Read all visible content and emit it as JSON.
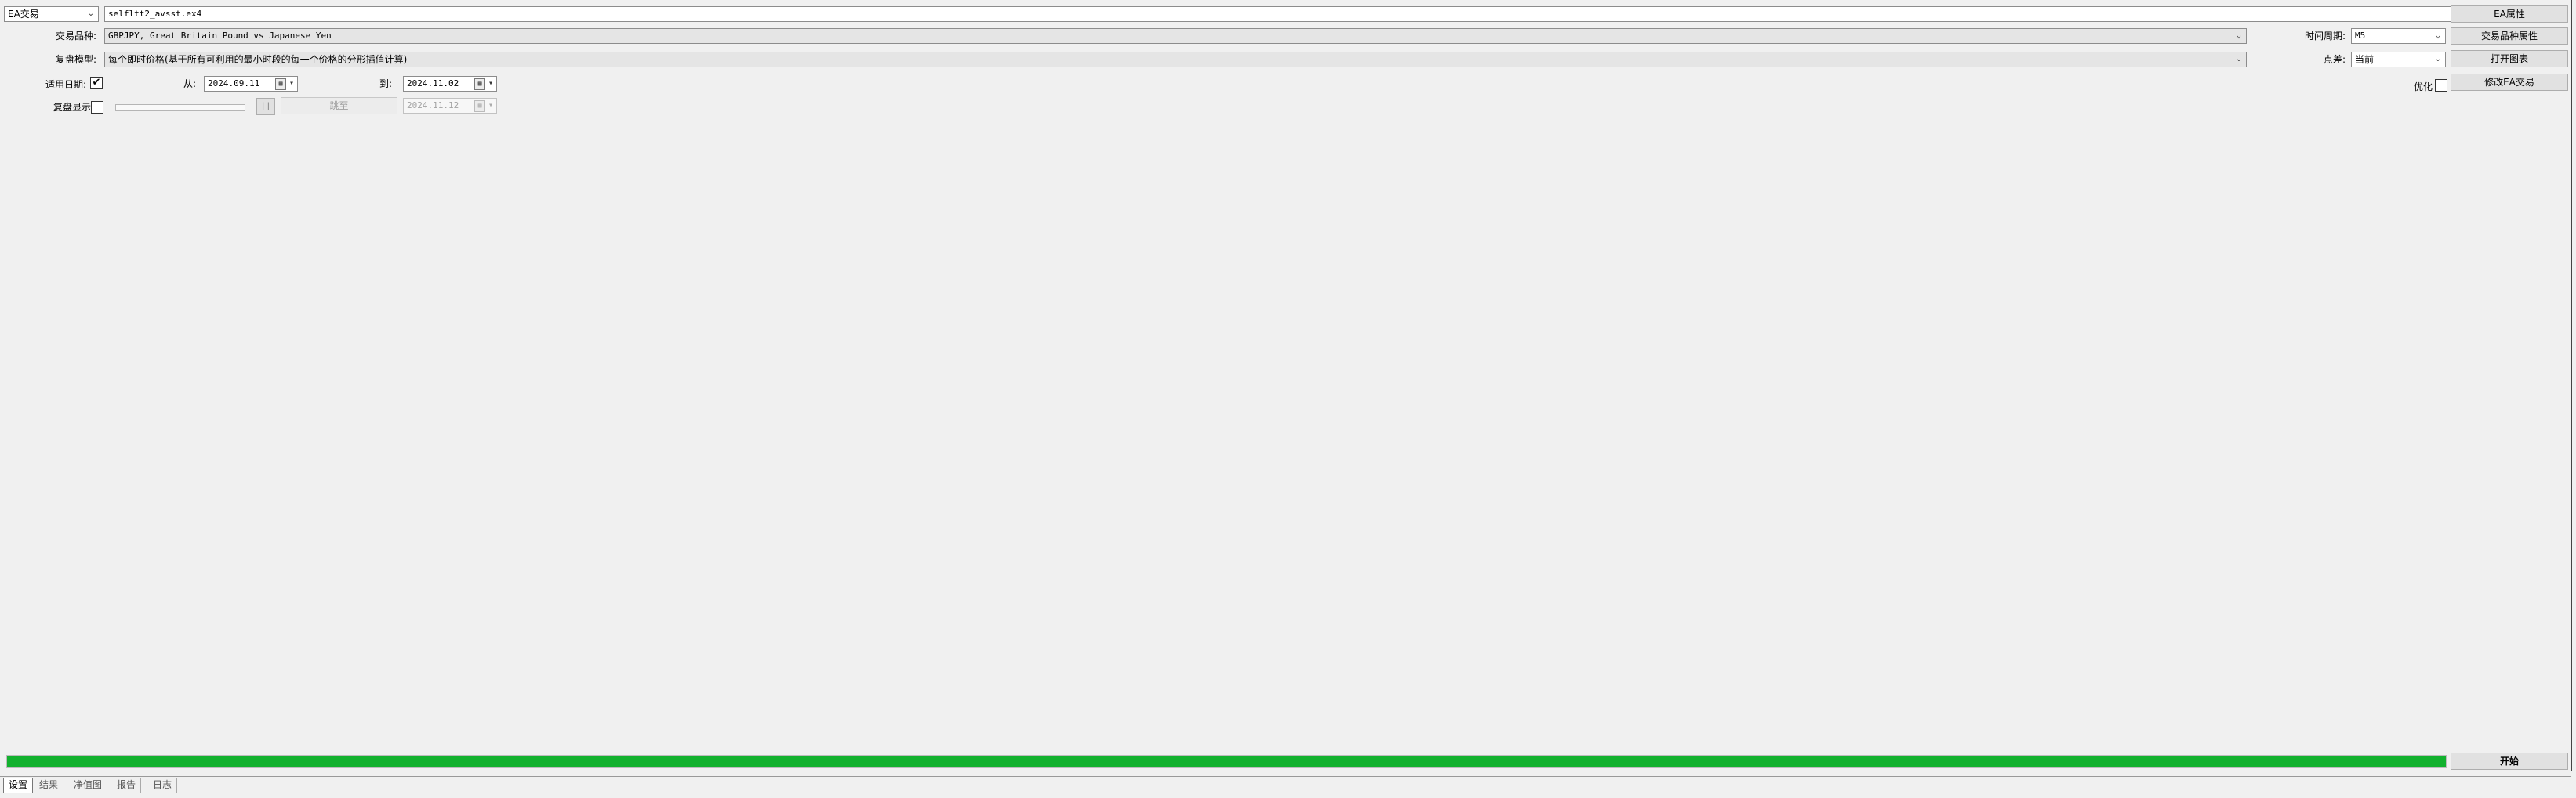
{
  "row1": {
    "mode_value": "EA交易",
    "expert_value": "selfltt2_avsst.ex4",
    "ea_props_button": "EA属性"
  },
  "row2": {
    "symbol_label": "交易品种:",
    "symbol_value": "GBPJPY, Great Britain Pound vs Japanese Yen",
    "period_label": "时间周期:",
    "period_value": "M5",
    "symbol_props_button": "交易品种属性"
  },
  "row3": {
    "model_label": "复盘模型:",
    "model_value": "每个即时价格(基于所有可利用的最小时段的每一个价格的分形插值计算)",
    "spread_label": "点差:",
    "spread_value": "当前",
    "open_chart_button": "打开图表"
  },
  "row4": {
    "use_date_label": "适用日期:",
    "use_date_checked": true,
    "from_label": "从:",
    "from_value": "2024.09.11",
    "to_label": "到:",
    "to_value": "2024.11.02",
    "optimize_label": "优化",
    "optimize_checked": false,
    "modify_ea_button": "修改EA交易"
  },
  "row5": {
    "visual_label": "复盘显示",
    "visual_checked": false,
    "speed_slider_level": 0,
    "pause_label": "| |",
    "skip_button": "跳至",
    "skip_date_value": "2024.11.12"
  },
  "progress": {
    "percent": 100,
    "color": "#12b12e",
    "start_button": "开始"
  },
  "tabs": [
    "设置",
    "结果",
    "净值图",
    "报告",
    "日志"
  ],
  "active_tab": 0
}
